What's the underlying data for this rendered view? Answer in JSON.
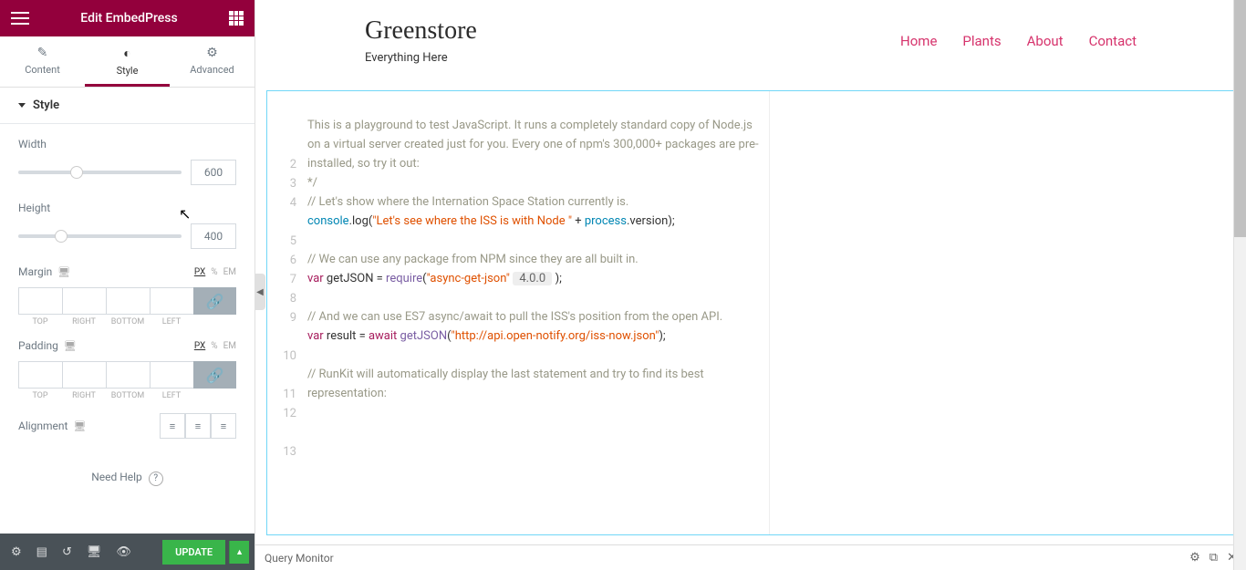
{
  "header": {
    "title": "Edit EmbedPress"
  },
  "tabs": {
    "content": "Content",
    "style": "Style",
    "advanced": "Advanced"
  },
  "style": {
    "section_title": "Style",
    "width_label": "Width",
    "width_value": "600",
    "height_label": "Height",
    "height_value": "400",
    "margin_label": "Margin",
    "padding_label": "Padding",
    "units": {
      "px": "PX",
      "pct": "%",
      "em": "EM"
    },
    "box_labels": {
      "top": "TOP",
      "right": "RIGHT",
      "bottom": "BOTTOM",
      "left": "LEFT"
    },
    "alignment_label": "Alignment"
  },
  "help": {
    "label": "Need Help",
    "q": "?"
  },
  "update_btn": "UPDATE",
  "site": {
    "title": "Greenstore",
    "subtitle": "Everything Here",
    "nav": {
      "home": "Home",
      "plants": "Plants",
      "about": "About",
      "contact": "Contact"
    }
  },
  "code": {
    "l2": "This is a playground to test JavaScript. It runs a completely standard copy of Node.js on a virtual server created just for you. Every one of npm's 300,000+ packages are pre-installed, so try it out:",
    "l3": "*/",
    "l4": "// Let's show where the Internation Space Station currently is.",
    "l5_pre": "console",
    "l5_log": ".log(",
    "l5_str": "\"Let's see where the ISS is with Node \"",
    "l5_post": " + ",
    "l5b_pre": "process",
    "l5b_post": ".version);",
    "l7": "// We can use any package from NPM since they are all built in.",
    "l8_var": "var ",
    "l8_name": "getJSON = ",
    "l8_req": "require",
    "l8_open": "(",
    "l8_str": "\"async-get-json\"",
    "l8_pill": " 4.0.0 ",
    "l8_close": ");",
    "l10": "// And we can use ES7 async/await to pull the ISS's position from the open API.",
    "l11_var": "var ",
    "l11_name": "result = ",
    "l11_await": "await ",
    "l11_fn": "getJSON",
    "l11_open": "(",
    "l11_str": "\"http://api.open-notify.org/iss-now.json\"",
    "l11_close": ");",
    "l13": "// RunKit will automatically display the last statement and try to find its best representation:"
  },
  "gutter": [
    "2",
    "3",
    "4",
    "5",
    "6",
    "7",
    "8",
    "9",
    "10",
    "11",
    "12",
    "13"
  ],
  "footer": {
    "label": "Query Monitor"
  }
}
